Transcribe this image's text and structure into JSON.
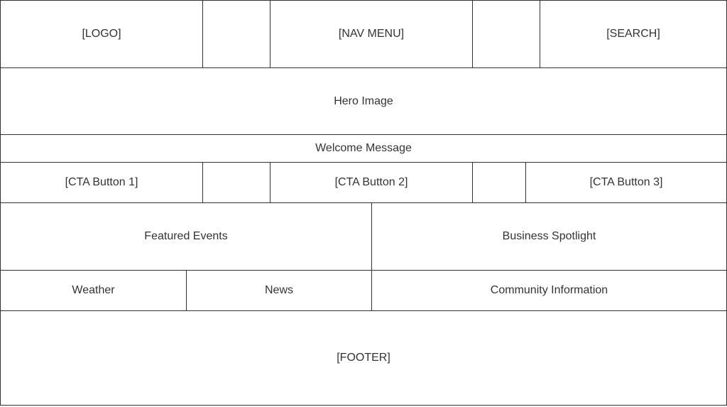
{
  "header": {
    "logo": "[LOGO]",
    "nav_menu": "[NAV MENU]",
    "search": "[SEARCH]"
  },
  "hero": {
    "label": "Hero Image"
  },
  "welcome": {
    "label": "Welcome Message"
  },
  "cta": {
    "button_1": "[CTA Button 1]",
    "button_2": "[CTA Button 2]",
    "button_3": "[CTA Button 3]"
  },
  "features": {
    "events": "Featured Events",
    "spotlight": "Business Spotlight"
  },
  "info": {
    "weather": "Weather",
    "news": "News",
    "community": "Community Information"
  },
  "footer": {
    "label": "[FOOTER]"
  }
}
